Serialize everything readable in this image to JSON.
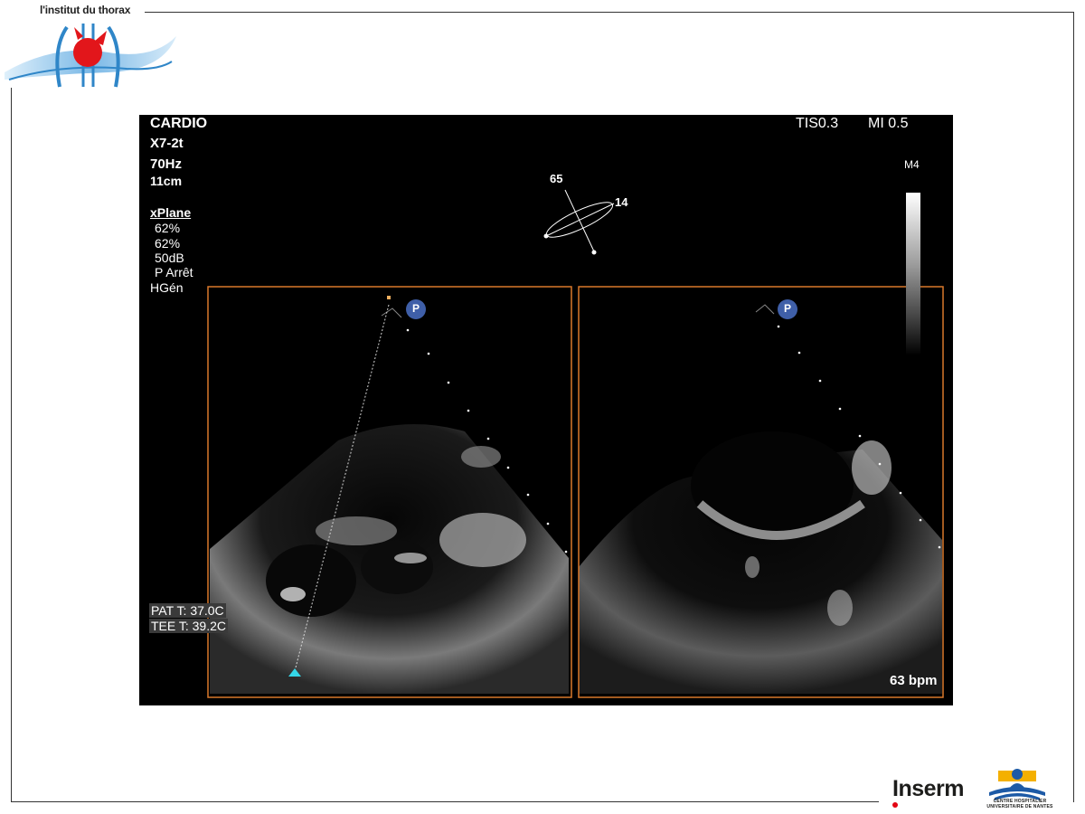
{
  "logo": {
    "institution": "l'institut du thorax"
  },
  "echo": {
    "mode": "CARDIO",
    "probe": "X7-2t",
    "frequency": "70Hz",
    "depth": "11cm",
    "xplane_label": "xPlane",
    "settings": [
      "62%",
      "62%",
      "50dB",
      "P Arrêt",
      "HGén"
    ],
    "tis": "TIS0.3",
    "mi": "MI 0.5",
    "map": "M4",
    "angle_primary": "65",
    "angle_secondary": "14",
    "orientation_marker": "P",
    "pat_temp": "PAT T: 37.0C",
    "tee_temp": "TEE T: 39.2C",
    "heart_rate": "63 bpm"
  },
  "footer": {
    "inserm": "Inserm",
    "chu_line1": "CENTRE HOSPITALIER",
    "chu_line2": "UNIVERSITAIRE DE NANTES"
  },
  "colors": {
    "frame_orange": "#d9782a",
    "cursor_cyan": "#35d6e8",
    "marker_blue": "#3f5fa8",
    "logo_red": "#e2161b",
    "logo_blue": "#2f86c8"
  }
}
